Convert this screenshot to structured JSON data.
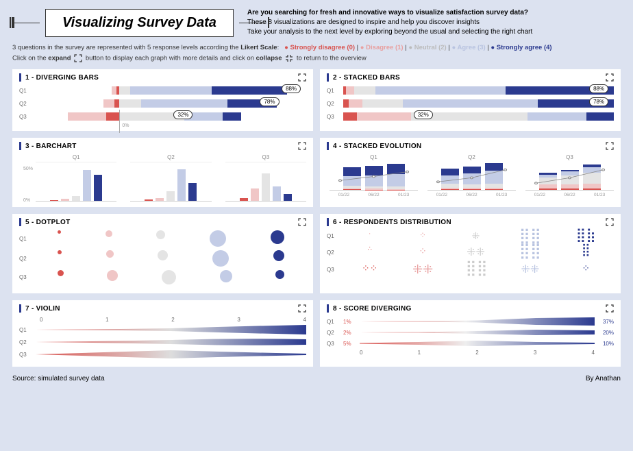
{
  "header": {
    "title": "Visualizing Survey Data",
    "sub_bold": "Are you searching for fresh and innovative ways to visualize satisfaction survey data?",
    "sub_l1": "These 8 visualizations are designed to inspire and help you discover insights",
    "sub_l2": "Take your analysis to the next level by exploring beyond the usual and selecting the right chart"
  },
  "info1_pre": "3 questions in the survey are represented with 5 response levels according the ",
  "info1_bold": "Likert Scale",
  "likert": {
    "sd": "Strongly disagree (0)",
    "d": "Disagree (1)",
    "n": "Neutral (2)",
    "a": "Agree (3)",
    "sa": "Strongly agree (4)"
  },
  "info2_pre": "Click on the ",
  "info2_expand": "expand",
  "info2_mid": " button to display each graph with more details and click on ",
  "info2_collapse": "collapse",
  "info2_post": " to return to the overview",
  "cards": {
    "c1": "1 - DIVERGING BARS",
    "c2": "2 - STACKED BARS",
    "c3": "3 - BARCHART",
    "c4": "4 - STACKED EVOLUTION",
    "c5": "5 - DOTPLOT",
    "c6": "6 - RESPONDENTS DISTRIBUTION",
    "c7": "7 - VIOLIN",
    "c8": "8 - SCORE DIVERGING"
  },
  "q": {
    "q1": "Q1",
    "q2": "Q2",
    "q3": "Q3"
  },
  "badges": {
    "b88": "88%",
    "b78": "78%",
    "b32": "32%"
  },
  "bc_y50": "50%",
  "bc_y0": "0%",
  "zero_pct": "0%",
  "se_periods": [
    "01/22",
    "06/22",
    "01/23"
  ],
  "violin_ticks": [
    "0",
    "1",
    "2",
    "3",
    "4"
  ],
  "sdv": {
    "q1_l": "1%",
    "q1_r": "37%",
    "q2_l": "2%",
    "q2_r": "20%",
    "q3_l": "5%",
    "q3_r": "10%",
    "x": [
      "0",
      "1",
      "2",
      "3",
      "4"
    ]
  },
  "footer": {
    "l": "Source: simulated survey data",
    "r": "By Anathan"
  },
  "chart_data": [
    {
      "id": "diverging_bars",
      "type": "bar",
      "orientation": "diverging-horizontal",
      "questions": [
        "Q1",
        "Q2",
        "Q3"
      ],
      "series": [
        {
          "name": "Strongly disagree",
          "values": [
            1,
            2,
            5
          ]
        },
        {
          "name": "Disagree",
          "values": [
            3,
            5,
            20
          ]
        },
        {
          "name": "Neutral",
          "values": [
            8,
            15,
            43
          ]
        },
        {
          "name": "Agree",
          "values": [
            48,
            50,
            22
          ]
        },
        {
          "name": "Strongly agree",
          "values": [
            40,
            28,
            10
          ]
        }
      ],
      "top2box": [
        88,
        78,
        32
      ]
    },
    {
      "id": "stacked_bars",
      "type": "bar",
      "orientation": "stacked-horizontal",
      "questions": [
        "Q1",
        "Q2",
        "Q3"
      ],
      "series": [
        {
          "name": "Strongly disagree",
          "values": [
            1,
            2,
            5
          ]
        },
        {
          "name": "Disagree",
          "values": [
            3,
            5,
            20
          ]
        },
        {
          "name": "Neutral",
          "values": [
            8,
            15,
            43
          ]
        },
        {
          "name": "Agree",
          "values": [
            48,
            50,
            22
          ]
        },
        {
          "name": "Strongly agree",
          "values": [
            40,
            28,
            10
          ]
        }
      ],
      "top2box": [
        88,
        78,
        32
      ]
    },
    {
      "id": "barchart",
      "type": "bar",
      "questions": [
        "Q1",
        "Q2",
        "Q3"
      ],
      "categories": [
        "Strongly disagree",
        "Disagree",
        "Neutral",
        "Agree",
        "Strongly agree"
      ],
      "values": {
        "Q1": [
          1,
          3,
          8,
          48,
          40
        ],
        "Q2": [
          2,
          5,
          15,
          50,
          28
        ],
        "Q3": [
          5,
          20,
          43,
          22,
          10
        ]
      },
      "ylabel": "%",
      "ylim": [
        0,
        60
      ],
      "yticks": [
        0,
        50
      ]
    },
    {
      "id": "stacked_evolution",
      "type": "area",
      "questions": [
        "Q1",
        "Q2",
        "Q3"
      ],
      "x": [
        "01/22",
        "06/22",
        "01/23"
      ],
      "series_per_question": {
        "Q1": [
          {
            "name": "Strongly disagree",
            "values": [
              2,
              1,
              1
            ]
          },
          {
            "name": "Disagree",
            "values": [
              5,
              4,
              3
            ]
          },
          {
            "name": "Neutral",
            "values": [
              12,
              10,
              8
            ]
          },
          {
            "name": "Agree",
            "values": [
              41,
              45,
              48
            ]
          },
          {
            "name": "Strongly agree",
            "values": [
              40,
              40,
              40
            ]
          }
        ],
        "Q2": [
          {
            "name": "Strongly disagree",
            "values": [
              3,
              2,
              2
            ]
          },
          {
            "name": "Disagree",
            "values": [
              8,
              6,
              5
            ]
          },
          {
            "name": "Neutral",
            "values": [
              19,
              17,
              15
            ]
          },
          {
            "name": "Agree",
            "values": [
              40,
              47,
              50
            ]
          },
          {
            "name": "Strongly agree",
            "values": [
              30,
              28,
              28
            ]
          }
        ],
        "Q3": [
          {
            "name": "Strongly disagree",
            "values": [
              8,
              6,
              5
            ]
          },
          {
            "name": "Disagree",
            "values": [
              24,
              22,
              20
            ]
          },
          {
            "name": "Neutral",
            "values": [
              40,
              42,
              43
            ]
          },
          {
            "name": "Agree",
            "values": [
              18,
              20,
              22
            ]
          },
          {
            "name": "Strongly agree",
            "values": [
              10,
              10,
              10
            ]
          }
        ]
      }
    },
    {
      "id": "dotplot",
      "type": "scatter",
      "questions": [
        "Q1",
        "Q2",
        "Q3"
      ],
      "categories": [
        "Strongly disagree",
        "Disagree",
        "Neutral",
        "Agree",
        "Strongly agree"
      ],
      "sizes": {
        "Q1": [
          4,
          10,
          14,
          30,
          24
        ],
        "Q2": [
          6,
          12,
          18,
          30,
          18
        ],
        "Q3": [
          10,
          20,
          26,
          22,
          14
        ]
      }
    },
    {
      "id": "respondents_distribution",
      "type": "scatter",
      "questions": [
        "Q1",
        "Q2",
        "Q3"
      ],
      "categories": [
        "Strongly disagree",
        "Disagree",
        "Neutral",
        "Agree",
        "Strongly agree"
      ],
      "counts": {
        "Q1": [
          2,
          6,
          8,
          48,
          40
        ],
        "Q2": [
          4,
          10,
          14,
          50,
          28
        ],
        "Q3": [
          10,
          24,
          42,
          22,
          10
        ]
      }
    },
    {
      "id": "violin",
      "type": "area",
      "questions": [
        "Q1",
        "Q2",
        "Q3"
      ],
      "x": [
        0,
        1,
        2,
        3,
        4
      ],
      "density": {
        "Q1": [
          0.02,
          0.05,
          0.15,
          0.55,
          0.8
        ],
        "Q2": [
          0.03,
          0.08,
          0.25,
          0.6,
          0.5
        ],
        "Q3": [
          0.1,
          0.35,
          0.7,
          0.4,
          0.2
        ]
      }
    },
    {
      "id": "score_diverging",
      "type": "area",
      "questions": [
        "Q1",
        "Q2",
        "Q3"
      ],
      "x": [
        0,
        1,
        2,
        3,
        4
      ],
      "bottom_pct": [
        1,
        2,
        5
      ],
      "top_pct": [
        37,
        20,
        10
      ],
      "thickness": {
        "Q1": [
          1,
          3,
          8,
          28,
          37
        ],
        "Q2": [
          2,
          5,
          15,
          30,
          20
        ],
        "Q3": [
          5,
          18,
          30,
          18,
          10
        ]
      }
    }
  ]
}
